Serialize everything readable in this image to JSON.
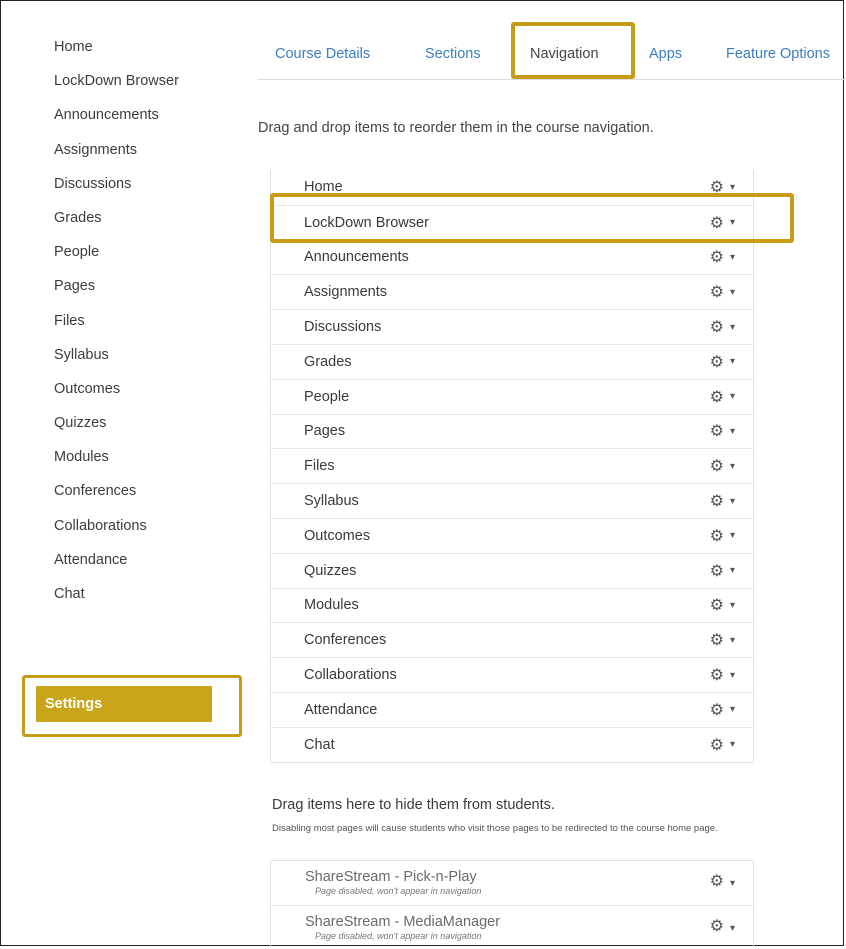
{
  "sidebar": {
    "items": [
      "Home",
      "LockDown Browser",
      "Announcements",
      "Assignments",
      "Discussions",
      "Grades",
      "People",
      "Pages",
      "Files",
      "Syllabus",
      "Outcomes",
      "Quizzes",
      "Modules",
      "Conferences",
      "Collaborations",
      "Attendance",
      "Chat"
    ],
    "active": "Settings"
  },
  "tabs": {
    "course_details": "Course Details",
    "sections": "Sections",
    "navigation": "Navigation",
    "apps": "Apps",
    "feature_options": "Feature Options"
  },
  "instructions": "Drag and drop items to reorder them in the course navigation.",
  "nav_items": [
    "Home",
    "LockDown Browser",
    "Announcements",
    "Assignments",
    "Discussions",
    "Grades",
    "People",
    "Pages",
    "Files",
    "Syllabus",
    "Outcomes",
    "Quizzes",
    "Modules",
    "Conferences",
    "Collaborations",
    "Attendance",
    "Chat"
  ],
  "controls": {
    "gear_icon": "gear-icon",
    "caret_icon": "caret-down-icon"
  },
  "hidden_section": {
    "title": "Drag items here to hide them from students.",
    "note": "Disabling most pages will cause students who visit those pages to be redirected to the course home page.",
    "items": [
      {
        "name": "ShareStream - Pick-n-Play",
        "status": "Page disabled, won't appear in navigation"
      },
      {
        "name": "ShareStream - MediaManager",
        "status": "Page disabled, won't appear in navigation"
      }
    ]
  },
  "colors": {
    "highlight": "#c89b17",
    "settings_bg": "#c9a51b",
    "link": "#3b7dbf"
  }
}
